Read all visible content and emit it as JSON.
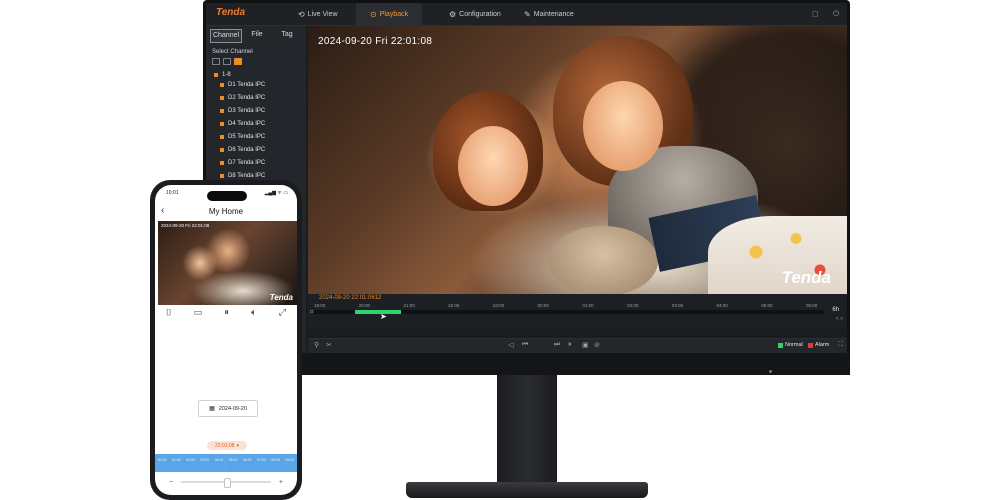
{
  "desktop": {
    "brand": "Tenda",
    "nav": [
      {
        "label": "Live View",
        "icon": "live-view-icon"
      },
      {
        "label": "Playback",
        "icon": "playback-icon"
      },
      {
        "label": "Configuration",
        "icon": "configuration-icon"
      },
      {
        "label": "Maintenance",
        "icon": "maintenance-icon"
      }
    ],
    "active_nav": "Playback",
    "sidebar": {
      "tabs": [
        "Channel",
        "File",
        "Tag"
      ],
      "active_tab": "Channel",
      "title": "Select Channel",
      "group": "1-8",
      "channels": [
        "D1 Tenda IPC",
        "D2 Tenda IPC",
        "D3 Tenda IPC",
        "D4 Tenda IPC",
        "D5 Tenda IPC",
        "D6 Tenda IPC",
        "D7 Tenda IPC",
        "D8 Tenda IPC"
      ]
    },
    "video": {
      "osd_time": "2024-09-20  Fri  22:01:08",
      "watermark": "Tenda"
    },
    "timeline": {
      "current": "2024-09-20 22:01:0612",
      "ticks": [
        "19:00",
        "20:00",
        "21:00",
        "22:00",
        "23:00",
        "00:00",
        "01:00",
        "02:00",
        "03:00",
        "04:00",
        "05:00",
        "06:00"
      ],
      "channel_label": "D1",
      "recorded_from": 0.08,
      "recorded_to": 0.17,
      "zoom": "6h",
      "zoom_nav": "< >"
    },
    "legend": {
      "normal": "Normal",
      "alarm": "Alarm",
      "normal_color": "#2fd46b",
      "alarm_color": "#e53935"
    },
    "accent_color": "#f08a24"
  },
  "phone": {
    "status_time": "10:01",
    "status_icons": "▂▄▆ ᯤ ▭",
    "title": "My Home",
    "osd_time": "2024-09-20 Fri 22:01:08",
    "watermark": "Tenda",
    "controls": [
      "snapshot-icon",
      "record-icon",
      "pause-icon",
      "volume-icon",
      "fullscreen-icon"
    ],
    "date": "2024-09-20",
    "time_pill": "22:01:08",
    "timeline_ticks": [
      "00:00",
      "01:00",
      "02:00",
      "03:00",
      "04:00",
      "05:00",
      "06:00",
      "07:00",
      "08:00",
      "09:00"
    ],
    "zoom_minus": "−",
    "zoom_plus": "+"
  }
}
